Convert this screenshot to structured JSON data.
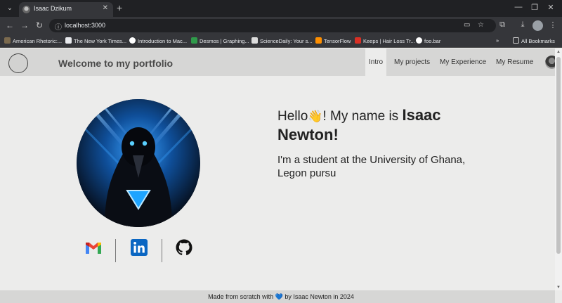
{
  "browser": {
    "tab_title": "Isaac Dzikum",
    "url": "localhost:3000",
    "bookmarks": [
      {
        "label": "American Rhetoric:...",
        "color": "#7b6a4e"
      },
      {
        "label": "The New York Times...",
        "color": "#e8eaed"
      },
      {
        "label": "Introduction to Mac...",
        "color": "#ffffff"
      },
      {
        "label": "Desmos | Graphing...",
        "color": "#2f9a4a"
      },
      {
        "label": "ScienceDaily: Your s...",
        "color": "#dcdcdc"
      },
      {
        "label": "TensorFlow",
        "color": "#ff8f00"
      },
      {
        "label": "Keeps | Hair Loss Tr...",
        "color": "#d93025"
      },
      {
        "label": "foo.bar",
        "color": "#ffffff"
      }
    ],
    "all_bookmarks_label": "All Bookmarks"
  },
  "site": {
    "title": "Welcome to my portfolio",
    "nav": [
      "Intro",
      "My projects",
      "My Experience",
      "My Resume"
    ],
    "active_nav": "Intro"
  },
  "intro": {
    "hello": "Hello",
    "wave": "👋",
    "name_prefix": "! My name is ",
    "name": "Isaac Newton!",
    "subtitle": "I'm a student at the University of Ghana, Legon pursu"
  },
  "social": [
    "gmail-icon",
    "linkedin-icon",
    "github-icon"
  ],
  "footer": {
    "prefix": "Made from scratch with",
    "heart": "💙",
    "suffix": "by Isaac Newton in 2024"
  }
}
